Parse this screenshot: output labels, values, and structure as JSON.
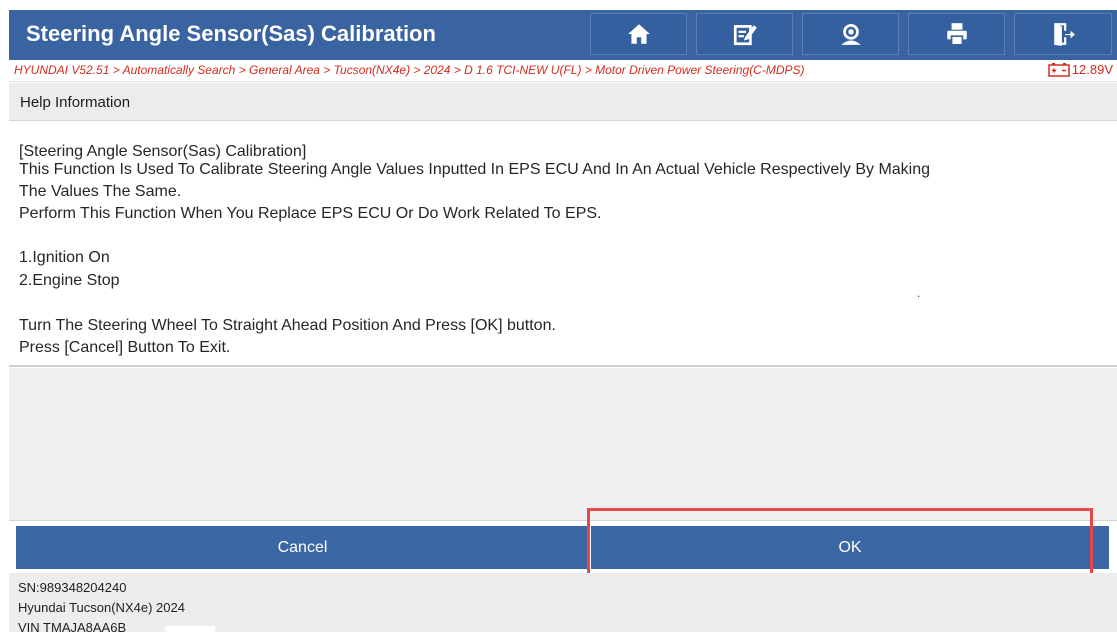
{
  "header": {
    "title": "Steering Angle Sensor(Sas) Calibration",
    "buttons": [
      {
        "icon": "home-icon"
      },
      {
        "icon": "edit-icon"
      },
      {
        "icon": "support-icon"
      },
      {
        "icon": "print-icon"
      },
      {
        "icon": "exit-icon"
      }
    ]
  },
  "breadcrumb": {
    "path": "HYUNDAI V52.51 > Automatically Search > General Area > Tucson(NX4e) > 2024 > D 1.6 TCI-NEW U(FL) > Motor Driven Power Steering(C-MDPS)",
    "voltage": "12.89V",
    "accent_color": "#d42b1f"
  },
  "help": {
    "header": "Help Information",
    "lines": [
      "[Steering Angle Sensor(Sas) Calibration]",
      " This Function Is Used To Calibrate Steering Angle Values Inputted In EPS ECU And In An Actual Vehicle Respectively By Making",
      "The Values The Same.",
      " Perform This Function When You Replace EPS ECU Or Do Work Related To EPS.",
      " 1.Ignition On",
      " 2.Engine Stop",
      "Turn The Steering Wheel To Straight Ahead Position And Press [OK] button.",
      "Press [Cancel] Button To Exit."
    ],
    "stray_mark": "."
  },
  "actions": {
    "cancel_label": "Cancel",
    "ok_label": "OK",
    "button_color": "#3b67a5",
    "highlight_color": "#e54848"
  },
  "footer": {
    "sn": "SN:989348204240",
    "vehicle": "Hyundai Tucson(NX4e) 2024",
    "vin": "VIN TMAJA8AA6B"
  },
  "colors": {
    "title_bar": "#3a63a1"
  }
}
